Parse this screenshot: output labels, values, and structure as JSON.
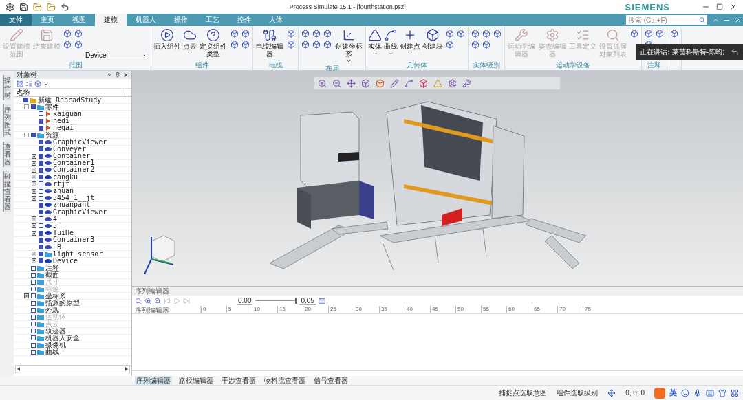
{
  "window": {
    "title": "Process Simulate 15.1 - [fourthstation.psz]",
    "brand": "SIEMENS"
  },
  "tabs": [
    {
      "label": "文件",
      "kind": "file",
      "selected": false
    },
    {
      "label": "主页",
      "kind": "tab",
      "selected": false
    },
    {
      "label": "视图",
      "kind": "tab",
      "selected": false
    },
    {
      "label": "建模",
      "kind": "tab",
      "selected": true
    },
    {
      "label": "机器人",
      "kind": "tab",
      "selected": false
    },
    {
      "label": "操作",
      "kind": "tab",
      "selected": false
    },
    {
      "label": "工艺",
      "kind": "tab",
      "selected": false
    },
    {
      "label": "控件",
      "kind": "tab",
      "selected": false
    },
    {
      "label": "人体",
      "kind": "tab",
      "selected": false
    }
  ],
  "search": {
    "placeholder": "搜索 (Ctrl+F)"
  },
  "ribbon": [
    {
      "label": "范围",
      "items": [
        {
          "kind": "large",
          "label": "设置建模范围",
          "disabled": true,
          "has_menu": false
        },
        {
          "kind": "large",
          "label": "结束建模",
          "disabled": true,
          "has_menu": false
        },
        {
          "kind": "small"
        },
        {
          "kind": "small"
        },
        {
          "kind": "small"
        },
        {
          "kind": "small"
        },
        {
          "kind": "dropdown",
          "value": "Device"
        }
      ]
    },
    {
      "label": "组件",
      "items": [
        {
          "kind": "large",
          "label": "插入组件",
          "disabled": false,
          "has_menu": false
        },
        {
          "kind": "large",
          "label": "点云",
          "disabled": false,
          "has_menu": true
        },
        {
          "kind": "large",
          "label": "定义组件类型",
          "disabled": false,
          "has_menu": false
        },
        {
          "kind": "small"
        },
        {
          "kind": "small"
        },
        {
          "kind": "small"
        },
        {
          "kind": "small"
        }
      ]
    },
    {
      "label": "电缆",
      "items": [
        {
          "kind": "large",
          "label": "电缆编辑器",
          "disabled": false,
          "has_menu": false
        },
        {
          "kind": "small"
        },
        {
          "kind": "small"
        }
      ]
    },
    {
      "label": "布局",
      "items": [
        {
          "kind": "small"
        },
        {
          "kind": "small"
        },
        {
          "kind": "small"
        },
        {
          "kind": "small"
        },
        {
          "kind": "small"
        },
        {
          "kind": "small"
        },
        {
          "kind": "large",
          "label": "创建坐标系",
          "disabled": false,
          "has_menu": true
        }
      ]
    },
    {
      "label": "几何体",
      "items": [
        {
          "kind": "large",
          "label": "实体",
          "disabled": false,
          "has_menu": true
        },
        {
          "kind": "large",
          "label": "曲线",
          "disabled": false,
          "has_menu": true
        },
        {
          "kind": "large",
          "label": "创建点",
          "disabled": false,
          "has_menu": true
        },
        {
          "kind": "large",
          "label": "创建块",
          "disabled": false,
          "has_menu": false
        },
        {
          "kind": "small"
        },
        {
          "kind": "small"
        },
        {
          "kind": "small"
        }
      ]
    },
    {
      "label": "实体级别",
      "items": [
        {
          "kind": "small"
        },
        {
          "kind": "small"
        },
        {
          "kind": "small"
        },
        {
          "kind": "small"
        },
        {
          "kind": "small"
        }
      ]
    },
    {
      "label": "运动学设备",
      "items": [
        {
          "kind": "large",
          "label": "运动学编辑器",
          "disabled": true,
          "has_menu": false
        },
        {
          "kind": "large",
          "label": "姿态编辑器",
          "disabled": true,
          "has_menu": false
        },
        {
          "kind": "large",
          "label": "工具定义",
          "disabled": true,
          "has_menu": false
        },
        {
          "kind": "large",
          "label": "设置抓握对象列表",
          "disabled": true,
          "has_menu": false
        },
        {
          "kind": "small"
        }
      ]
    },
    {
      "label": "注释",
      "items": [
        {
          "kind": "small"
        },
        {
          "kind": "small"
        },
        {
          "kind": "small"
        }
      ]
    },
    {
      "items": [
        {
          "kind": "small"
        }
      ]
    }
  ],
  "notification": {
    "text": "正在讲话: 莱茵科斯特-陈昀;"
  },
  "side_tabs": [
    {
      "label": "操作树"
    },
    {
      "label": "序列图式"
    },
    {
      "label": "查看器"
    },
    {
      "label": "碰撞查看器"
    }
  ],
  "object_tree": {
    "title": "对象树",
    "column": "名称",
    "nodes": [
      {
        "label": "新建 RobcadStudy",
        "kind": "study",
        "checked": true,
        "dimmed": false,
        "expanded": true,
        "children": [
          {
            "label": "零件",
            "kind": "folder",
            "checked": true,
            "dimmed": false,
            "expanded": true,
            "children": [
              {
                "label": "kaiguan",
                "kind": "part",
                "checked": false,
                "dimmed": false
              },
              {
                "label": "hedi",
                "kind": "part",
                "checked": true,
                "dimmed": false
              },
              {
                "label": "hegai",
                "kind": "part",
                "checked": true,
                "dimmed": false
              }
            ]
          },
          {
            "label": "资源",
            "kind": "folder",
            "checked": true,
            "dimmed": false,
            "expanded": true,
            "children": [
              {
                "label": "GraphicViewer",
                "kind": "viewer",
                "checked": true,
                "dimmed": false
              },
              {
                "label": "Conveyer",
                "kind": "conveyor",
                "checked": true,
                "dimmed": false
              },
              {
                "label": "Container",
                "kind": "container",
                "checked": true,
                "dimmed": false,
                "expanded": false
              },
              {
                "label": "Container1",
                "kind": "container",
                "checked": true,
                "dimmed": false,
                "expanded": false
              },
              {
                "label": "Container2",
                "kind": "container",
                "checked": true,
                "dimmed": false,
                "expanded": false
              },
              {
                "label": "cangku",
                "kind": "device",
                "checked": true,
                "dimmed": false,
                "expanded": false
              },
              {
                "label": "rtjt",
                "kind": "resource",
                "checked": false,
                "dimmed": false,
                "expanded": false
              },
              {
                "label": "zhuan",
                "kind": "resource",
                "checked": false,
                "dimmed": false,
                "expanded": false
              },
              {
                "label": "5454_1__jt",
                "kind": "resource",
                "checked": false,
                "dimmed": false,
                "expanded": false
              },
              {
                "label": "zhuanpant",
                "kind": "device",
                "checked": true,
                "dimmed": false
              },
              {
                "label": "GraphicViewer",
                "kind": "viewer",
                "checked": true,
                "dimmed": false
              },
              {
                "label": "4",
                "kind": "resource",
                "checked": false,
                "dimmed": false,
                "expanded": false
              },
              {
                "label": "5",
                "kind": "resource",
                "checked": false,
                "dimmed": false,
                "expanded": false
              },
              {
                "label": "TuiHe",
                "kind": "device",
                "checked": true,
                "dimmed": false,
                "expanded": false
              },
              {
                "label": "Container3",
                "kind": "container",
                "checked": true,
                "dimmed": false
              },
              {
                "label": "LB",
                "kind": "resource",
                "checked": true,
                "dimmed": false
              },
              {
                "label": "light_sensor",
                "kind": "folder",
                "checked": true,
                "dimmed": false,
                "expanded": false
              },
              {
                "label": "Device",
                "kind": "device",
                "checked": true,
                "dimmed": false,
                "expanded": false
              }
            ]
          },
          {
            "label": "注释",
            "kind": "folder",
            "checked": false,
            "dimmed": false
          },
          {
            "label": "截面",
            "kind": "folder",
            "checked": false,
            "dimmed": false
          },
          {
            "label": "尺寸",
            "kind": "folder",
            "checked": false,
            "dimmed": true
          },
          {
            "label": "标签",
            "kind": "folder",
            "checked": false,
            "dimmed": true
          },
          {
            "label": "坐标系",
            "kind": "folder",
            "checked": false,
            "dimmed": false,
            "expanded": false
          },
          {
            "label": "指派的原型",
            "kind": "folder",
            "checked": false,
            "dimmed": false
          },
          {
            "label": "外观",
            "kind": "folder",
            "checked": false,
            "dimmed": false
          },
          {
            "label": "运动体",
            "kind": "folder",
            "checked": false,
            "dimmed": true
          },
          {
            "label": "点云",
            "kind": "folder",
            "checked": false,
            "dimmed": true
          },
          {
            "label": "轨迹器",
            "kind": "folder",
            "checked": false,
            "dimmed": false
          },
          {
            "label": "机器人安全",
            "kind": "folder",
            "checked": false,
            "dimmed": false
          },
          {
            "label": "摄像机",
            "kind": "folder",
            "checked": false,
            "dimmed": false
          },
          {
            "label": "曲线",
            "kind": "folder",
            "checked": false,
            "dimmed": false
          }
        ]
      }
    ]
  },
  "sequence_editor": {
    "title": "序列编辑器",
    "time": "0.00",
    "step": "0.05",
    "level": 1,
    "column": "序列编辑器",
    "ruler": [
      "0",
      "5",
      "10",
      "15",
      "20",
      "25",
      "30",
      "35",
      "40",
      "45",
      "50",
      "55",
      "60",
      "65",
      "70",
      "75"
    ]
  },
  "bottom_tabs": [
    {
      "label": "序列编辑器",
      "selected": true
    },
    {
      "label": "路径编辑器",
      "selected": false
    },
    {
      "label": "干涉查看器",
      "selected": false
    },
    {
      "label": "物料流查看器",
      "selected": false
    },
    {
      "label": "信号查看器",
      "selected": false
    }
  ],
  "status_bar": {
    "items": [
      "捕捉点选取意图",
      "组件选取级别"
    ],
    "coords": "0, 0, 0",
    "ime": "英"
  }
}
